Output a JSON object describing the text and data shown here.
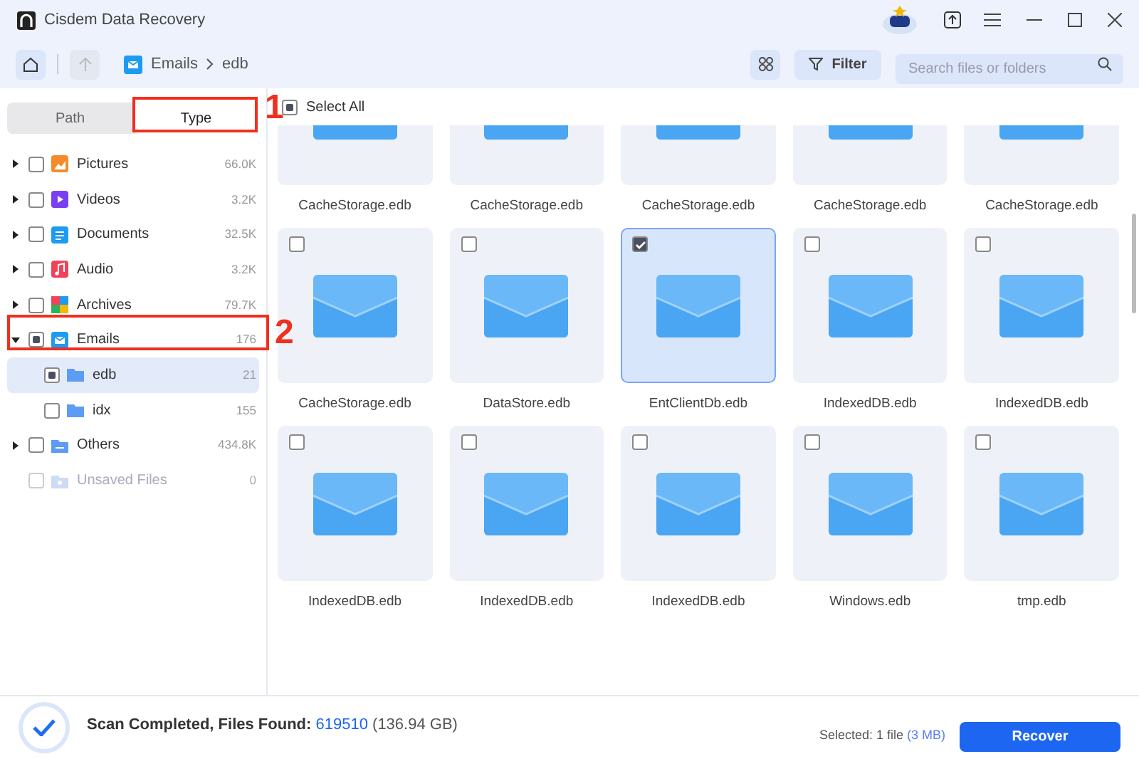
{
  "window": {
    "title": "Cisdem Data Recovery"
  },
  "breadcrumb": [
    "Emails",
    "edb"
  ],
  "toolbar": {
    "filter": "Filter",
    "search": {
      "placeholder": "Search files or folders"
    }
  },
  "tabs": [
    {
      "label": "Path",
      "selected": false
    },
    {
      "label": "Type",
      "selected": true
    }
  ],
  "tree": [
    {
      "kind": "pictures",
      "label": "Pictures",
      "count": "66.0K",
      "expanded": false,
      "checked": false,
      "partial": false,
      "selected": false,
      "disabled": false
    },
    {
      "kind": "videos",
      "label": "Videos",
      "count": "3.2K",
      "expanded": false,
      "checked": false,
      "partial": false,
      "selected": false,
      "disabled": false
    },
    {
      "kind": "documents",
      "label": "Documents",
      "count": "32.5K",
      "expanded": false,
      "checked": false,
      "partial": false,
      "selected": false,
      "disabled": false
    },
    {
      "kind": "audio",
      "label": "Audio",
      "count": "3.2K",
      "expanded": false,
      "checked": false,
      "partial": false,
      "selected": false,
      "disabled": false
    },
    {
      "kind": "archives",
      "label": "Archives",
      "count": "79.7K",
      "expanded": false,
      "checked": false,
      "partial": false,
      "selected": false,
      "disabled": false
    },
    {
      "kind": "emails",
      "label": "Emails",
      "count": "176",
      "expanded": true,
      "partial": true,
      "selected": false,
      "disabled": false,
      "children": [
        {
          "kind": "folder",
          "label": "edb",
          "count": "21",
          "partial": true,
          "selected": true,
          "disabled": false
        },
        {
          "kind": "folder",
          "label": "idx",
          "count": "155",
          "checked": false,
          "partial": false,
          "selected": false,
          "disabled": false
        }
      ]
    },
    {
      "kind": "others",
      "label": "Others",
      "count": "434.8K",
      "expanded": false,
      "checked": false,
      "partial": false,
      "selected": false,
      "disabled": false
    },
    {
      "kind": "unsaved",
      "label": "Unsaved Files",
      "count": "0",
      "checked": false,
      "partial": false,
      "selected": false,
      "disabled": true
    }
  ],
  "select_all": {
    "label": "Select All",
    "partial": true
  },
  "files": [
    {
      "name": "CacheStorage.edb",
      "selected": false
    },
    {
      "name": "CacheStorage.edb",
      "selected": false
    },
    {
      "name": "CacheStorage.edb",
      "selected": false
    },
    {
      "name": "CacheStorage.edb",
      "selected": false
    },
    {
      "name": "CacheStorage.edb",
      "selected": false
    },
    {
      "name": "CacheStorage.edb",
      "checked": false,
      "selected": false
    },
    {
      "name": "DataStore.edb",
      "checked": false,
      "selected": false
    },
    {
      "name": "EntClientDb.edb",
      "checked": true,
      "selected": true
    },
    {
      "name": "IndexedDB.edb",
      "checked": false,
      "selected": false
    },
    {
      "name": "IndexedDB.edb",
      "checked": false,
      "selected": false
    },
    {
      "name": "IndexedDB.edb",
      "checked": false,
      "selected": false
    },
    {
      "name": "IndexedDB.edb",
      "checked": false,
      "selected": false
    },
    {
      "name": "IndexedDB.edb",
      "checked": false,
      "selected": false
    },
    {
      "name": "Windows.edb",
      "checked": false,
      "selected": false
    },
    {
      "name": "tmp.edb",
      "checked": false,
      "selected": false
    }
  ],
  "status_bar": {
    "message": "Scan Completed, Files Found: ",
    "files_found": "619510",
    "size": "(136.94 GB)",
    "selected": "Selected: 1 file",
    "selected_size": "(3 MB)",
    "recover": "Recover"
  },
  "callouts": [
    {
      "label": "1",
      "kind": "tab"
    },
    {
      "label": "2",
      "kind": "tree"
    }
  ]
}
